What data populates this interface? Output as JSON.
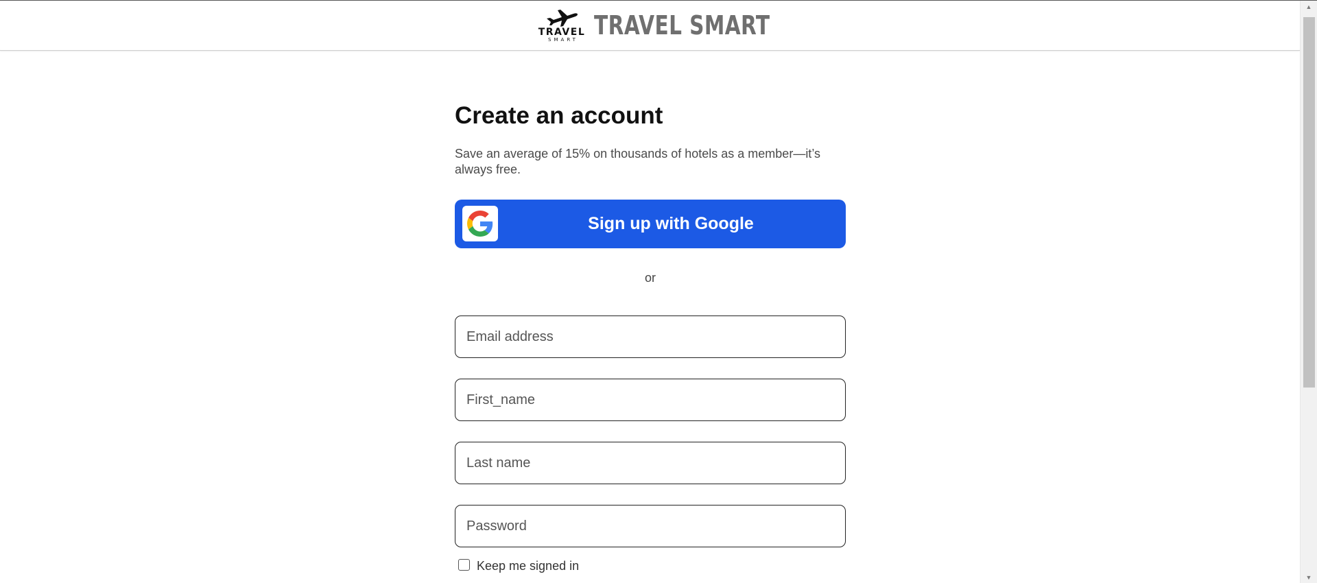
{
  "header": {
    "logo": {
      "mark_word": "TRAVEL",
      "mark_subword": "SMART",
      "icon": "airplane-icon"
    },
    "brand_name": "TRAVEL SMART"
  },
  "signup": {
    "title": "Create an account",
    "subtitle": "Save an average of 15% on thousands of hotels as a member—it’s always free.",
    "google_button_label": "Sign up with Google",
    "google_icon": "google-g-icon",
    "divider_text": "or",
    "fields": {
      "email_placeholder": "Email address",
      "first_name_placeholder": "First_name",
      "last_name_placeholder": "Last name",
      "password_placeholder": "Password"
    },
    "keep_signed_in_label": "Keep me signed in",
    "keep_signed_in_checked": false
  },
  "colors": {
    "google_button_bg": "#1c5ae5",
    "brand_text": "#6f6f6f",
    "title_text": "#111111"
  }
}
